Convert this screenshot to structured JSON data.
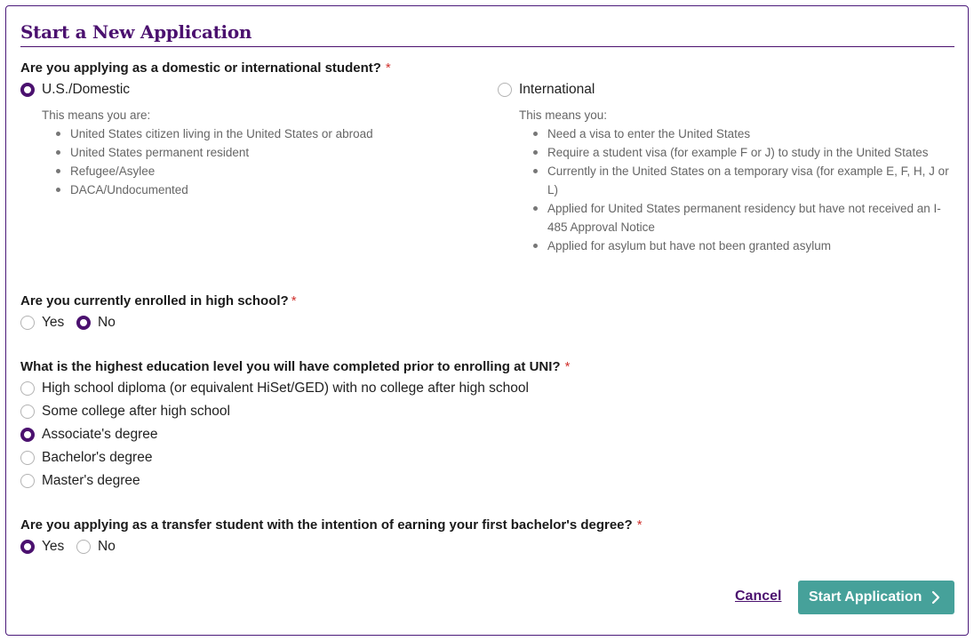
{
  "title": "Start a New Application",
  "q1": {
    "label": "Are you applying as a domestic or international student?",
    "required": "*",
    "options": [
      {
        "label": "U.S./Domestic",
        "checked": true,
        "intro": "This means you are:",
        "bullets": [
          "United States citizen living in the United States or abroad",
          "United States permanent resident",
          "Refugee/Asylee",
          "DACA/Undocumented"
        ]
      },
      {
        "label": "International",
        "checked": false,
        "intro": "This means you:",
        "bullets": [
          "Need a visa to enter the United States",
          "Require a student visa (for example F or J) to study in the United States",
          "Currently in the United States on a temporary visa (for example E, F, H, J or L)",
          "Applied for United States permanent residency but have not received an I-485 Approval Notice",
          "Applied for asylum but have not been granted asylum"
        ]
      }
    ]
  },
  "q2": {
    "label": "Are you currently enrolled in high school?",
    "required": "*",
    "options": [
      {
        "label": "Yes",
        "checked": false
      },
      {
        "label": "No",
        "checked": true
      }
    ]
  },
  "q3": {
    "label": "What is the highest education level you will have completed prior to enrolling at UNI?",
    "required": "*",
    "options": [
      {
        "label": "High school diploma (or equivalent HiSet/GED) with no college after high school",
        "checked": false
      },
      {
        "label": "Some college after high school",
        "checked": false
      },
      {
        "label": "Associate's degree",
        "checked": true
      },
      {
        "label": "Bachelor's degree",
        "checked": false
      },
      {
        "label": "Master's degree",
        "checked": false
      }
    ]
  },
  "q4": {
    "label": "Are you applying as a transfer student with the intention of earning your first bachelor's degree?",
    "required": "*",
    "options": [
      {
        "label": "Yes",
        "checked": true
      },
      {
        "label": "No",
        "checked": false
      }
    ]
  },
  "actions": {
    "cancel_label": "Cancel",
    "start_label": "Start Application"
  },
  "colors": {
    "brand_purple": "#4b116f",
    "primary_button": "#46a19a",
    "required_asterisk": "#d0312d"
  }
}
